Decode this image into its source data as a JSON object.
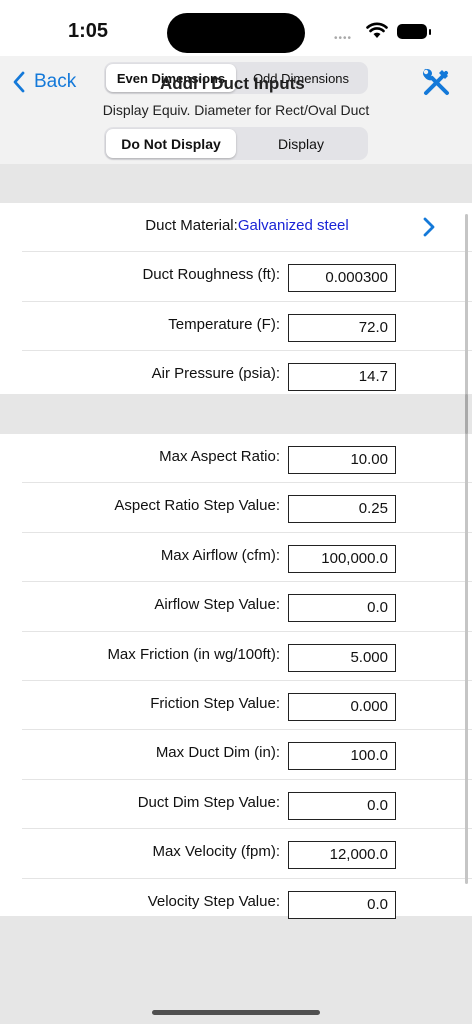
{
  "status_bar": {
    "time": "1:05",
    "signal": "••••"
  },
  "nav": {
    "back_label": "Back",
    "title": "Addl'l Duct Inputs",
    "dimension_tabs": [
      "Even Dimensions",
      "Odd Dimensions"
    ],
    "selected_dimension_tab": "Even Dimensions",
    "equiv_label": "Display Equiv. Diameter for Rect/Oval Duct",
    "equiv_options": [
      "Do Not Display",
      "Display"
    ],
    "selected_equiv_option": "Do Not Display"
  },
  "material": {
    "label": "Duct Material:",
    "value": "Galvanized steel"
  },
  "section1": [
    {
      "label": "Duct Roughness (ft):",
      "value": "0.000300"
    },
    {
      "label": "Temperature (F):",
      "value": "72.0"
    },
    {
      "label": "Air Pressure (psia):",
      "value": "14.7"
    }
  ],
  "section2": [
    {
      "label": "Max Aspect Ratio:",
      "value": "10.00"
    },
    {
      "label": "Aspect Ratio Step Value:",
      "value": "0.25"
    },
    {
      "label": "Max Airflow (cfm):",
      "value": "100,000.0"
    },
    {
      "label": "Airflow Step Value:",
      "value": "0.0"
    },
    {
      "label": "Max Friction (in wg/100ft):",
      "value": "5.000"
    },
    {
      "label": "Friction Step Value:",
      "value": "0.000"
    },
    {
      "label": "Max Duct Dim (in):",
      "value": "100.0"
    },
    {
      "label": "Duct Dim Step Value:",
      "value": "0.0"
    },
    {
      "label": "Max Velocity (fpm):",
      "value": "12,000.0"
    },
    {
      "label": "Velocity Step Value:",
      "value": "0.0"
    }
  ],
  "colors": {
    "accent": "#1479d9",
    "material_value": "#1a24d6",
    "background": "#e6e6e6"
  }
}
